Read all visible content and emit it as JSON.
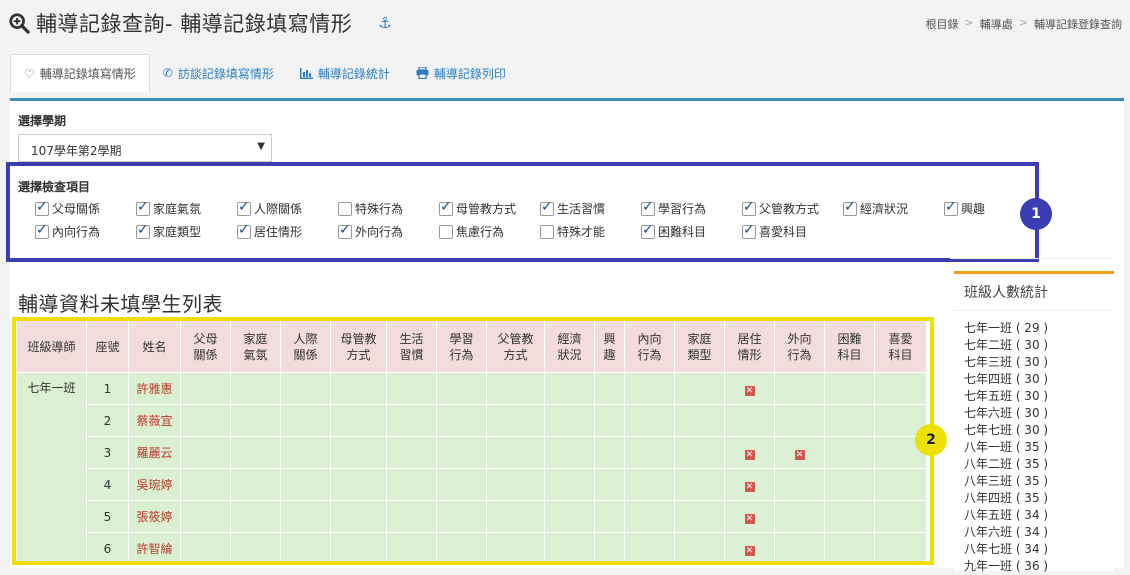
{
  "header": {
    "title": "輔導記錄查詢- 輔導記錄填寫情形",
    "icons": {
      "zoom": "zoom-in-icon",
      "anchor": "anchor-icon"
    }
  },
  "breadcrumb": [
    "根目錄",
    "輔導處",
    "輔導記錄登錄查詢"
  ],
  "tabs": [
    {
      "label": "輔導記錄填寫情形",
      "icon": "heart-icon",
      "active": true
    },
    {
      "label": "訪談記錄填寫情形",
      "icon": "phone-icon",
      "active": false
    },
    {
      "label": "輔導記錄統計",
      "icon": "bar-chart-icon",
      "active": false
    },
    {
      "label": "輔導記錄列印",
      "icon": "print-icon",
      "active": false
    }
  ],
  "term": {
    "label": "選擇學期",
    "selected": "107學年第2學期"
  },
  "checks": {
    "label": "選擇檢查項目",
    "items": [
      {
        "label": "父母關係",
        "checked": true
      },
      {
        "label": "家庭氣氛",
        "checked": true
      },
      {
        "label": "人際關係",
        "checked": true
      },
      {
        "label": "特殊行為",
        "checked": false
      },
      {
        "label": "母管教方式",
        "checked": true
      },
      {
        "label": "生活習慣",
        "checked": true
      },
      {
        "label": "學習行為",
        "checked": true
      },
      {
        "label": "父管教方式",
        "checked": true
      },
      {
        "label": "經濟狀況",
        "checked": true
      },
      {
        "label": "興趣",
        "checked": true
      },
      {
        "label": "內向行為",
        "checked": true
      },
      {
        "label": "家庭類型",
        "checked": true
      },
      {
        "label": "居住情形",
        "checked": true
      },
      {
        "label": "外向行為",
        "checked": true
      },
      {
        "label": "焦慮行為",
        "checked": false
      },
      {
        "label": "特殊才能",
        "checked": false
      },
      {
        "label": "困難科目",
        "checked": true
      },
      {
        "label": "喜愛科目",
        "checked": true
      }
    ]
  },
  "badges": {
    "one": "1",
    "two": "2"
  },
  "list": {
    "title": "輔導資料未填學生列表",
    "headers": [
      "班級導師",
      "座號",
      "姓名",
      "父母\n關係",
      "家庭\n氣氛",
      "人際\n關係",
      "母管教\n方式",
      "生活\n習慣",
      "學習\n行為",
      "父管教\n方式",
      "經濟\n狀況",
      "興\n趣",
      "內向\n行為",
      "家庭\n類型",
      "居住\n情形",
      "外向\n行為",
      "困難\n科目",
      "喜愛\n科目"
    ],
    "teacher": "七年一班",
    "rows": [
      {
        "seat": "1",
        "name": "許雅惠",
        "missing": [
          "居住情形"
        ]
      },
      {
        "seat": "2",
        "name": "蔡薇宜",
        "missing": []
      },
      {
        "seat": "3",
        "name": "羅麗云",
        "missing": [
          "居住情形",
          "外向行為"
        ]
      },
      {
        "seat": "4",
        "name": "吳琬婷",
        "missing": [
          "居住情形"
        ]
      },
      {
        "seat": "5",
        "name": "張筱婷",
        "missing": [
          "居住情形"
        ]
      },
      {
        "seat": "6",
        "name": "許智綸",
        "missing": [
          "居住情形"
        ]
      }
    ]
  },
  "side": {
    "title": "班級人數統計",
    "classes": [
      "七年一班 ( 29 )",
      "七年二班 ( 30 )",
      "七年三班 ( 30 )",
      "七年四班 ( 30 )",
      "七年五班 ( 30 )",
      "七年六班 ( 30 )",
      "七年七班 ( 30 )",
      "八年一班 ( 35 )",
      "八年二班 ( 35 )",
      "八年三班 ( 35 )",
      "八年四班 ( 35 )",
      "八年五班 ( 34 )",
      "八年六班 ( 34 )",
      "八年七班 ( 34 )",
      "九年一班 ( 36 )"
    ]
  }
}
